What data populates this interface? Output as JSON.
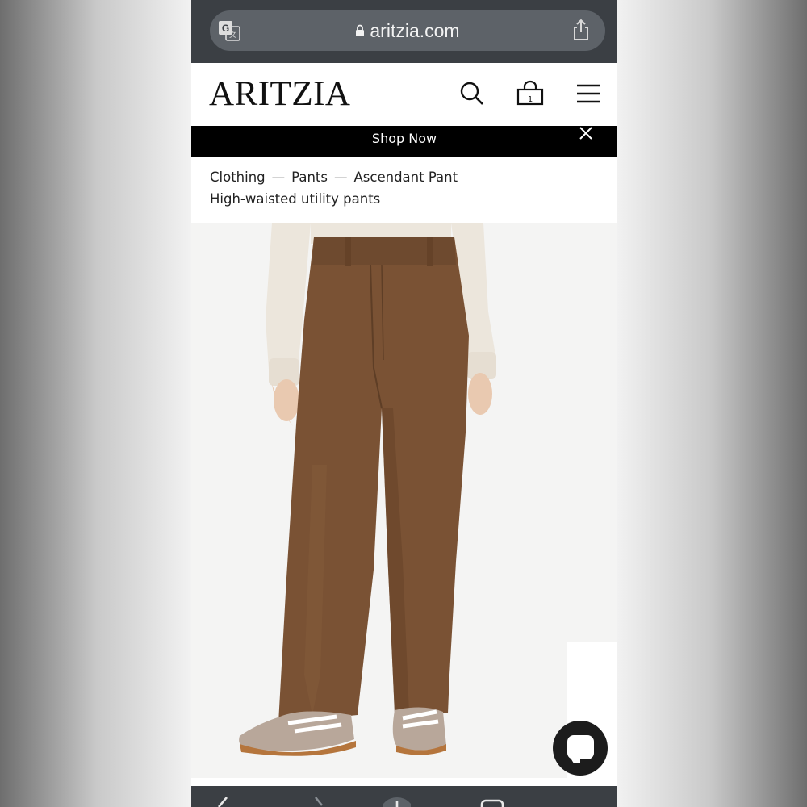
{
  "browser": {
    "url": "aritzia.com",
    "icons": [
      "translate-icon",
      "lock-icon",
      "share-icon"
    ]
  },
  "header": {
    "logo": "ARITZIA",
    "bag_count": "1",
    "icons": [
      "search-icon",
      "bag-icon",
      "menu-icon"
    ]
  },
  "promo": {
    "link_text": "Shop Now"
  },
  "breadcrumb": {
    "items": [
      "Clothing",
      "—",
      "Pants",
      "—",
      "Ascendant Pant"
    ]
  },
  "product": {
    "subtitle": "High-waisted utility pants"
  },
  "colors": {
    "browser_chrome": "#3b3f44",
    "url_pill": "#5d6268",
    "promo_bg": "#000000",
    "pants": "#7a5234",
    "sweater": "#ece6dc"
  },
  "chat": {
    "icon": "chat-icon"
  },
  "bottom_bar": {
    "icons": [
      "back-icon",
      "forward-icon",
      "new-tab-icon",
      "tabs-icon"
    ]
  }
}
